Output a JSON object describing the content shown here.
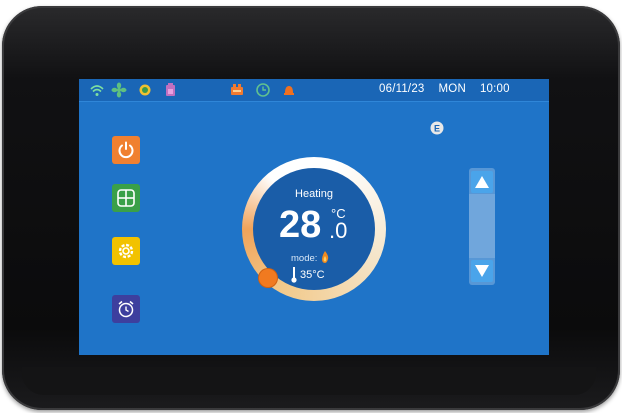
{
  "status_bar": {
    "date": "06/11/23",
    "day": "MON",
    "time": "10:00",
    "icons": [
      "wifi-icon",
      "fan-icon",
      "snowflake-sun-icon",
      "battery-icon",
      "heater-icon",
      "clock-icon",
      "alarm-bell-icon"
    ]
  },
  "thermostat": {
    "mode_title": "Heating",
    "temperature_integer": "28",
    "temperature_decimal": ".0",
    "unit": "°C",
    "mode_label": "mode:",
    "mode_icon": "flame-icon",
    "setpoint": "35",
    "setpoint_unit": "°C"
  },
  "side_buttons": [
    {
      "name": "power-icon",
      "color": "#f08030"
    },
    {
      "name": "mode-grid-icon",
      "color": "#3aa048"
    },
    {
      "name": "settings-gear-icon",
      "color": "#f2c200"
    },
    {
      "name": "alarm-clock-icon",
      "color": "#3d3f9e"
    }
  ],
  "colors": {
    "screen_bg": "#1f74c8",
    "accent_orange": "#f07a20",
    "bezel": "#0b0b0c"
  }
}
